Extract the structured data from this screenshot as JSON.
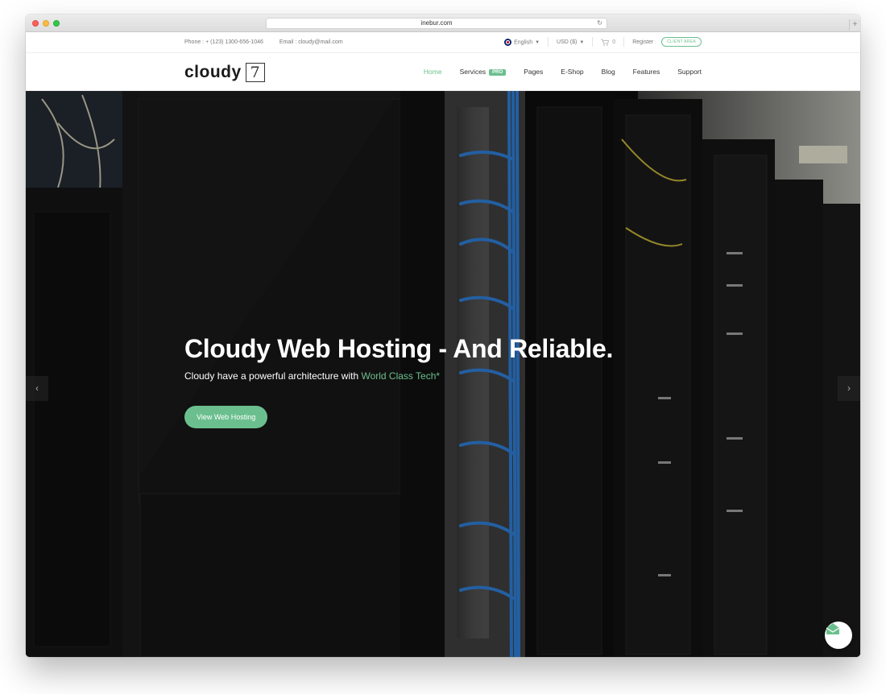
{
  "browser": {
    "url": "inebur.com",
    "reload_icon": "reload-icon",
    "new_tab_icon": "plus-icon"
  },
  "topbar": {
    "phone": "Phone : + (123) 1300-656-1046",
    "email": "Email : cloudy@mail.com",
    "language": "English",
    "currency": "USD ($)",
    "cart_count": "0",
    "register": "Register",
    "client_area": "CLIENT AREA"
  },
  "nav": {
    "logo_text": "cloudy",
    "logo_number": "7",
    "items": [
      {
        "label": "Home",
        "active": true
      },
      {
        "label": "Services",
        "badge": "PRO"
      },
      {
        "label": "Pages"
      },
      {
        "label": "E-Shop"
      },
      {
        "label": "Blog"
      },
      {
        "label": "Features"
      },
      {
        "label": "Support"
      }
    ]
  },
  "hero": {
    "title": "Cloudy Web Hosting - And Reliable.",
    "subtitle_prefix": "Cloudy have a powerful architecture with ",
    "subtitle_accent": "World Class Tech*",
    "button": "View Web Hosting",
    "prev_arrow": "‹",
    "next_arrow": "›"
  },
  "colors": {
    "accent": "#6bbf8e",
    "hero_bg": "#0c0c0c",
    "cable_blue": "#2f7fd8"
  }
}
